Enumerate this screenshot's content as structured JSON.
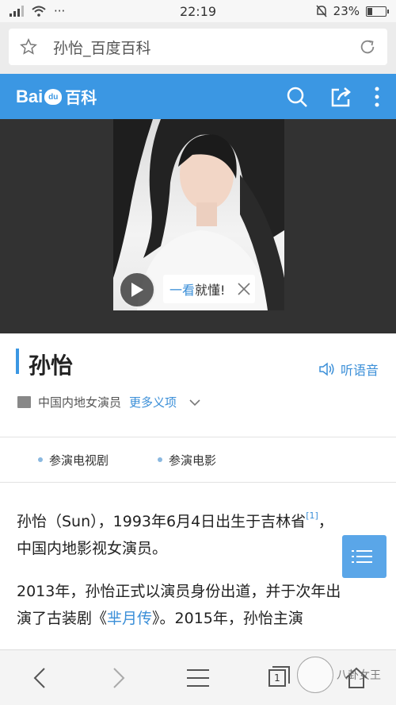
{
  "status_bar": {
    "time": "22:19",
    "battery_text": "23%",
    "battery_level": 0.23,
    "signal_icon": "signal-icon",
    "wifi_icon": "wifi-icon",
    "dots": "···"
  },
  "browser": {
    "url_title": "孙怡_百度百科",
    "star_icon": "star-icon",
    "reload_icon": "reload-icon"
  },
  "header": {
    "logo_text_1": "Bai",
    "logo_paw": "du",
    "logo_text_2": "百科",
    "icons": [
      "search-icon",
      "share-icon",
      "more-vertical-icon"
    ]
  },
  "hero": {
    "video_tip_prefix": "一看",
    "video_tip_suffix": "就懂!"
  },
  "entry": {
    "title": "孙怡",
    "listen_label": "听语音",
    "description": "中国内地女演员",
    "more_meanings": "更多义项"
  },
  "tabs": [
    {
      "label": "参演电视剧"
    },
    {
      "label": "参演电影"
    }
  ],
  "content": {
    "p1_part1": "孙怡（Sun），1993年6月4日出生于吉林省",
    "p1_sup": "[1]",
    "p1_part2": "，中国内地影视女演员。",
    "p2_part1": "2013年，孙怡正式以演员身份出道，并于次年出演了古装剧《",
    "p2_link": "芈月传",
    "p2_part2": "》。2015年，孙怡主演"
  },
  "bottom_nav": {
    "tab_count": "1",
    "icons": [
      "back-icon",
      "forward-icon",
      "menu-icon",
      "tabs-icon",
      "home-icon"
    ]
  },
  "watermark": {
    "text": "八卦女王"
  }
}
